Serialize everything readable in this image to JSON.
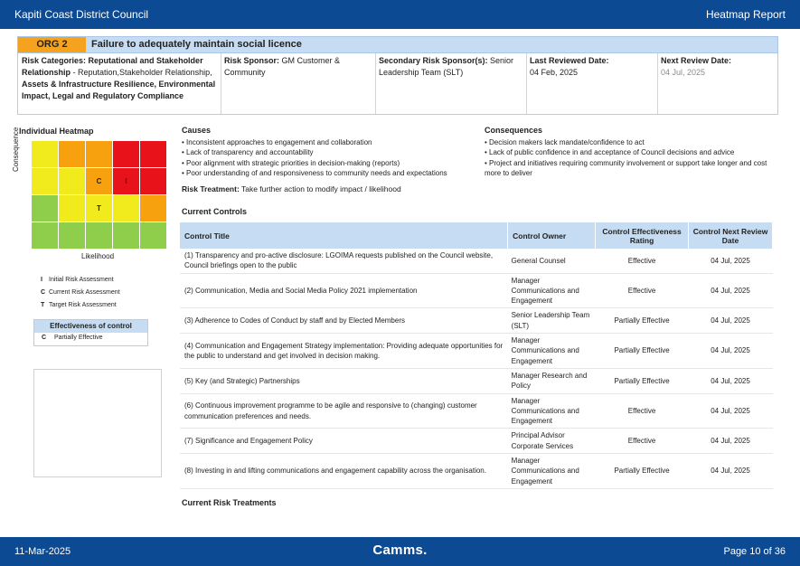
{
  "header": {
    "org": "Kapiti Coast District Council",
    "report": "Heatmap Report"
  },
  "footer": {
    "date": "11-Mar-2025",
    "brand": "Camms.",
    "page": "Page 10 of 36"
  },
  "risk": {
    "code": "ORG 2",
    "title": "Failure to adequately maintain social licence",
    "categories_label": "Risk Categories:",
    "categories_value_1": "Reputational and Stakeholder Relationship",
    "categories_value_2": " - Reputation,Stakeholder Relationship, ",
    "categories_value_3": "Assets & Infrastructure Resilience, Environmental Impact, Legal and Regulatory Compliance",
    "sponsor_label": "Risk Sponsor:",
    "sponsor_value": " GM Customer & Community",
    "secondary_label": "Secondary Risk Sponsor(s):",
    "secondary_value": " Senior Leadership Team (SLT)",
    "last_reviewed_label": "Last Reviewed Date:",
    "last_reviewed_value": "04 Feb, 2025",
    "next_review_label": "Next Review Date:",
    "next_review_value": "04 Jul, 2025"
  },
  "heatmap": {
    "title": "Individual Heatmap",
    "y_label": "Consequence",
    "x_label": "Likelihood",
    "colors": {
      "red": "#e8121a",
      "orange": "#f7a10f",
      "yellow": "#f1ea1c",
      "green": "#8fce4a"
    },
    "grid": [
      [
        "yellow",
        "orange",
        "orange",
        "red",
        "red"
      ],
      [
        "yellow",
        "yellow",
        "orange",
        "red",
        "red"
      ],
      [
        "green",
        "yellow",
        "yellow",
        "yellow",
        "orange"
      ],
      [
        "green",
        "green",
        "green",
        "green",
        "green"
      ]
    ],
    "markers": [
      {
        "label": "C",
        "row": 1,
        "col": 2
      },
      {
        "label": "I",
        "row": 1,
        "col": 3
      },
      {
        "label": "T",
        "row": 2,
        "col": 2
      }
    ],
    "legend": [
      {
        "key": "I",
        "text": "Initial Risk Assessment"
      },
      {
        "key": "C",
        "text": "Current Risk Assessment"
      },
      {
        "key": "T",
        "text": "Target Risk Assessment"
      }
    ],
    "effectiveness_title": "Effectiveness of control",
    "effectiveness_key": "C",
    "effectiveness_value": "Partially Effective"
  },
  "causes": {
    "title": "Causes",
    "items": [
      "• Inconsistent approaches to engagement and collaboration",
      "• Lack of transparency and accountability",
      "• Poor alignment with strategic priorities in decision-making (reports)",
      "• Poor understanding of and responsiveness to community needs and expectations"
    ]
  },
  "consequences": {
    "title": "Consequences",
    "items": [
      "• Decision makers lack mandate/confidence to act",
      "• Lack of public confidence in and acceptance of Council decisions and advice",
      "• Project and initiatives requiring community involvement or support take longer and cost more to deliver"
    ]
  },
  "treatment": {
    "label": "Risk Treatment:",
    "value": " Take further action to modify impact / likelihood"
  },
  "controls": {
    "title": "Current Controls",
    "columns": [
      "Control Title",
      "Control Owner",
      "Control Effectiveness Rating",
      "Control Next Review Date"
    ],
    "rows": [
      {
        "title": "(1) Transparency and pro-active disclosure: LGOIMA requests published on the Council website, Council briefings open to the public",
        "owner": "General Counsel",
        "rating": "Effective",
        "date": "04 Jul, 2025"
      },
      {
        "title": "(2) Communication, Media and Social Media Policy 2021 implementation",
        "owner": "Manager Communications and Engagement",
        "rating": "Effective",
        "date": "04 Jul, 2025"
      },
      {
        "title": "(3) Adherence to Codes of Conduct by staff and by Elected Members",
        "owner": "Senior Leadership Team (SLT)",
        "rating": "Partially Effective",
        "date": "04 Jul, 2025"
      },
      {
        "title": "(4) Communication and Engagement Strategy implementation: Providing adequate opportunities for the public to understand and get involved in decision making.",
        "owner": "Manager Communications and Engagement",
        "rating": "Partially Effective",
        "date": "04 Jul, 2025"
      },
      {
        "title": "(5) Key (and Strategic) Partnerships",
        "owner": "Manager Research and Policy",
        "rating": "Partially Effective",
        "date": "04 Jul, 2025"
      },
      {
        "title": "(6) Continuous improvement programme to be agile and responsive to (changing) customer communication preferences and needs.",
        "owner": "Manager Communications and Engagement",
        "rating": "Effective",
        "date": "04 Jul, 2025"
      },
      {
        "title": "(7) Significance and Engagement Policy",
        "owner": "Principal Advisor Corporate Services",
        "rating": "Effective",
        "date": "04 Jul, 2025"
      },
      {
        "title": "(8) Investing in and lifting communications and engagement capability across the organisation.",
        "owner": "Manager Communications and Engagement",
        "rating": "Partially Effective",
        "date": "04 Jul, 2025"
      }
    ]
  },
  "treatments": {
    "title": "Current Risk Treatments"
  }
}
